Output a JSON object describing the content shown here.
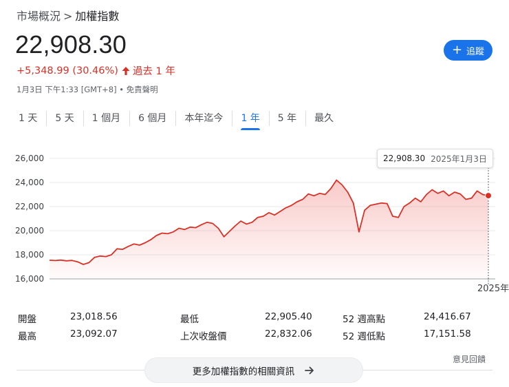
{
  "breadcrumb": {
    "parent": "市場概況",
    "separator": ">",
    "current": "加權指數"
  },
  "quote": {
    "price": "22,908.30",
    "change": "+5,348.99 (30.46%)",
    "period": "過去 1 年",
    "timestamp": "1月3日 下午1:33 [GMT+8] • 免責聲明"
  },
  "follow_button": {
    "label": "追蹤",
    "icon": "plus-icon"
  },
  "tabs": [
    {
      "label": "1 天",
      "active": false
    },
    {
      "label": "5 天",
      "active": false
    },
    {
      "label": "1 個月",
      "active": false
    },
    {
      "label": "6 個月",
      "active": false
    },
    {
      "label": "本年迄今",
      "active": false
    },
    {
      "label": "1 年",
      "active": true
    },
    {
      "label": "5 年",
      "active": false
    },
    {
      "label": "最久",
      "active": false
    }
  ],
  "tooltip": {
    "value": "22,908.30",
    "date": "2025年1月3日"
  },
  "stats": {
    "open_label": "開盤",
    "open": "23,018.56",
    "high_label": "最高",
    "high": "23,092.07",
    "low_label": "最低",
    "low": "22,905.40",
    "prev_close_label": "上次收盤價",
    "prev_close": "22,832.06",
    "w52_high_label": "52 週高點",
    "w52_high": "24,416.67",
    "w52_low_label": "52 週低點",
    "w52_low": "17,151.58"
  },
  "feedback": "意見回饋",
  "more_button": {
    "label": "更多加權指數的相關資訊",
    "icon": "arrow-right-icon"
  },
  "colors": {
    "line": "#d93025",
    "accent": "#1a73e8",
    "axis": "#202124"
  },
  "chart_data": {
    "type": "area",
    "yticks": [
      "26,000",
      "24,000",
      "22,000",
      "20,000",
      "18,000",
      "16,000"
    ],
    "ylim": [
      16000,
      26000
    ],
    "xtick_label": "2025年",
    "x_index_range": [
      0,
      78
    ],
    "baseline": 16000,
    "values": [
      17550,
      17520,
      17560,
      17500,
      17530,
      17420,
      17200,
      17350,
      17780,
      17900,
      17850,
      18000,
      18500,
      18450,
      18700,
      18900,
      18800,
      19000,
      19250,
      19600,
      19800,
      19750,
      19900,
      20200,
      20100,
      20300,
      20250,
      20500,
      20700,
      20600,
      20200,
      19500,
      19950,
      20400,
      20800,
      20550,
      20700,
      21100,
      21200,
      21500,
      21300,
      21600,
      21900,
      22100,
      22400,
      22600,
      23050,
      22900,
      23100,
      23000,
      23500,
      24200,
      23800,
      23200,
      22300,
      19900,
      21700,
      22100,
      22200,
      22300,
      22250,
      21200,
      21100,
      22000,
      22300,
      22700,
      22400,
      23000,
      23400,
      23100,
      23300,
      22900,
      23200,
      23050,
      22600,
      22700,
      23300,
      23000,
      22908
    ],
    "last_point": 22908.3
  }
}
